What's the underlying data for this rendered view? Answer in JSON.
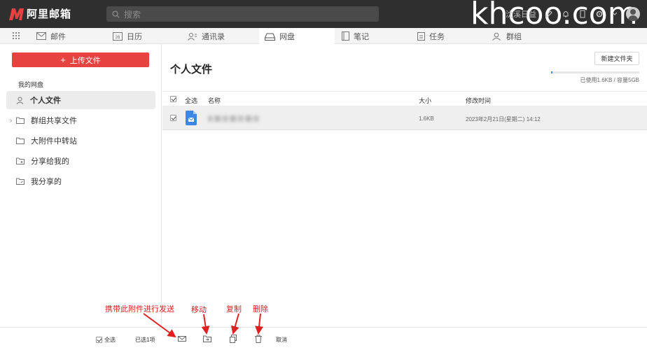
{
  "topbar": {
    "logo_text": "阿里邮箱",
    "search_placeholder": "搜索",
    "user_name": "沈溪日益",
    "watermark": "khcoo.com"
  },
  "nav": {
    "items": [
      {
        "label": "邮件",
        "icon": "mail-icon"
      },
      {
        "label": "日历",
        "icon": "calendar-icon",
        "badge": "26"
      },
      {
        "label": "通讯录",
        "icon": "contacts-icon"
      },
      {
        "label": "网盘",
        "icon": "drive-icon",
        "active": true
      },
      {
        "label": "笔记",
        "icon": "note-icon"
      },
      {
        "label": "任务",
        "icon": "task-icon"
      },
      {
        "label": "群组",
        "icon": "group-icon"
      }
    ]
  },
  "sidebar": {
    "upload_label": "上传文件",
    "section_label": "我的网盘",
    "items": [
      {
        "label": "个人文件",
        "icon": "user-icon",
        "active": true
      },
      {
        "label": "群组共享文件",
        "icon": "folder-group-icon"
      },
      {
        "label": "大附件中转站",
        "icon": "folder-icon"
      },
      {
        "label": "分享给我的",
        "icon": "folder-shared-icon"
      },
      {
        "label": "我分享的",
        "icon": "folder-share-icon"
      }
    ]
  },
  "main": {
    "title": "个人文件",
    "new_folder_label": "新建文件夹",
    "storage_text": "已使用1.6KB / 容量5GB",
    "storage_used_fraction": 3e-07,
    "columns": {
      "select_all": "全选",
      "name": "名称",
      "size": "大小",
      "modified": "修改时间"
    },
    "files": [
      {
        "name": "",
        "size": "1.6KB",
        "modified": "2023年2月21日(星期二) 14:12",
        "selected": true
      }
    ]
  },
  "bottombar": {
    "select_all": "全选",
    "selected_count": "已选1项",
    "cancel": "取消"
  },
  "annotations": {
    "send_attachment": "携带此附件进行发送",
    "move": "移动",
    "copy": "复制",
    "delete": "删除"
  },
  "colors": {
    "accent_red": "#e64340",
    "topbar_bg": "#2f2f2f",
    "storage_blue": "#3c8ee8",
    "annotation_red": "#e02020"
  }
}
